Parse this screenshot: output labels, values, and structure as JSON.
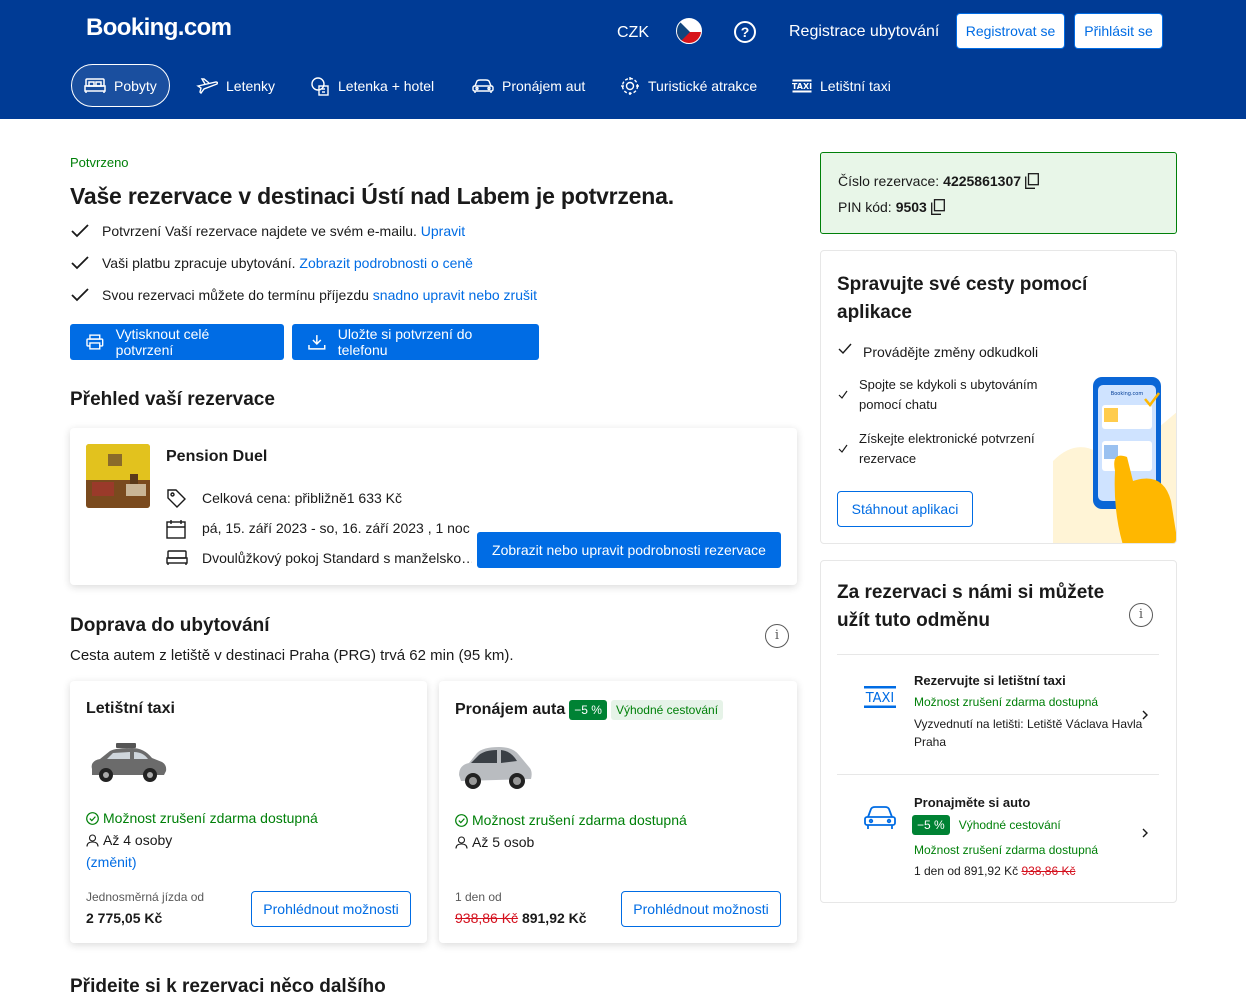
{
  "header": {
    "logo": "Booking.com",
    "currency": "CZK",
    "help": "?",
    "list_property": "Registrace ubytování",
    "register": "Registrovat se",
    "sign_in": "Přihlásit se",
    "nav": [
      {
        "label": "Pobyty",
        "icon": "bed-icon",
        "active": true
      },
      {
        "label": "Letenky",
        "icon": "plane-icon"
      },
      {
        "label": "Letenka + hotel",
        "icon": "flight-hotel-icon"
      },
      {
        "label": "Pronájem aut",
        "icon": "car-icon"
      },
      {
        "label": "Turistické atrakce",
        "icon": "attractions-icon"
      },
      {
        "label": "Letištní taxi",
        "icon": "taxi-icon"
      }
    ]
  },
  "confirmation": {
    "status": "Potvrzeno",
    "title": "Vaše rezervace v destinaci Ústí nad Labem je potvrzena.",
    "checks": [
      {
        "text": "Potvrzení Vaší rezervace najdete ve svém e-mailu.",
        "link": "Upravit"
      },
      {
        "text": "Vaši platbu zpracuje ubytování.",
        "link": "Zobrazit podrobnosti o ceně"
      },
      {
        "text": "Svou rezervaci můžete do termínu příjezdu",
        "link": "snadno upravit nebo zrušit"
      }
    ],
    "print_button": "Vytisknout celé potvrzení",
    "save_button": "Uložte si potvrzení do telefonu"
  },
  "overview": {
    "heading": "Přehled vaší rezervace",
    "property_name": "Pension Duel",
    "price": "Celková cena: přibližně1 633 Kč",
    "dates": "pá, 15. září 2023 - so, 16. září 2023 , 1 noc",
    "room": "Dvoulůžkový pokoj Standard s manželsko…",
    "manage_button": "Zobrazit nebo upravit podrobnosti rezervace"
  },
  "transport": {
    "heading": "Doprava do ubytování",
    "subtitle": "Cesta autem z letiště v destinaci Praha (PRG) trvá 62 min (95 km).",
    "info": "i",
    "taxi": {
      "title": "Letištní taxi",
      "free_cancel": "Možnost zrušení zdarma dostupná",
      "capacity": "Až 4 osoby",
      "change": "(změnit)",
      "price_label": "Jednosměrná jízda od",
      "price": "2 775,05 Kč",
      "button": "Prohlédnout možnosti"
    },
    "car": {
      "title": "Pronájem auta",
      "discount": "−5 %",
      "deal": "Výhodné cestování",
      "free_cancel": "Možnost zrušení zdarma dostupná",
      "capacity": "Až 5 osob",
      "price_label": "1 den od",
      "old_price": "938,86 Kč",
      "price": "891,92 Kč",
      "button": "Prohlédnout možnosti"
    }
  },
  "next_heading": "Přidejte si k rezervaci něco dalšího",
  "reservation_box": {
    "number_label": "Číslo rezervace:",
    "number": "4225861307",
    "pin_label": "PIN kód:",
    "pin": "9503"
  },
  "app_promo": {
    "title": "Spravujte své cesty pomocí aplikace",
    "items": [
      "Provádějte změny odkudkoli",
      "Spojte se kdykoli s ubytováním pomocí chatu",
      "Získejte elektronické potvrzení rezervace"
    ],
    "button": "Stáhnout aplikaci",
    "phone_brand": "Booking.com"
  },
  "reward": {
    "title": "Za rezervaci s námi si můžete užít tuto odměnu",
    "info": "i",
    "taxi": {
      "title": "Rezervujte si letištní taxi",
      "free_cancel": "Možnost zrušení zdarma dostupná",
      "detail": "Vyzvednutí na letišti: Letiště Václava Havla Praha"
    },
    "car": {
      "title": "Pronajměte si auto",
      "discount": "−5 %",
      "deal": "Výhodné cestování",
      "free_cancel": "Možnost zrušení zdarma dostupná",
      "price_prefix": "1 den od 891,92 Kč",
      "old_price": "938,86 Kč"
    },
    "taxi_icon_text": "TAXI"
  },
  "colors": {
    "brand": "#003b95",
    "accent": "#006ce4",
    "success": "#008009"
  }
}
